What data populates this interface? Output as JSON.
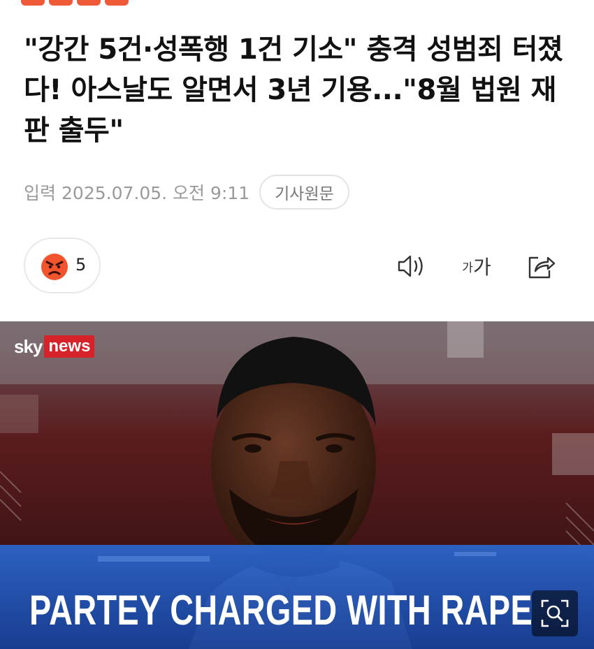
{
  "article": {
    "headline": "\"강간 5건·성폭행 1건 기소\" 충격 성범죄 터졌다! 아스날도 알면서 3년 기용...\"8월 법원 재판 출두\"",
    "published_label": "입력",
    "published_datetime": "2025.07.05. 오전 9:11",
    "original_link_label": "기사원문"
  },
  "reaction": {
    "icon": "angry-face-icon",
    "count": "5",
    "color": "#f2542d"
  },
  "toolbar": {
    "speaker_icon": "speaker-icon",
    "font_small": "가",
    "font_big": "가",
    "share_icon": "share-icon"
  },
  "hero": {
    "broadcaster_sky": "sky",
    "broadcaster_news": "news",
    "banner_text": "PARTEY CHARGED WITH RAPE",
    "zoom_icon": "zoom-icon"
  },
  "colors": {
    "brand": "#ef5a38",
    "sky_news_red": "#d8222a",
    "banner_blue": "#1f4fae"
  }
}
